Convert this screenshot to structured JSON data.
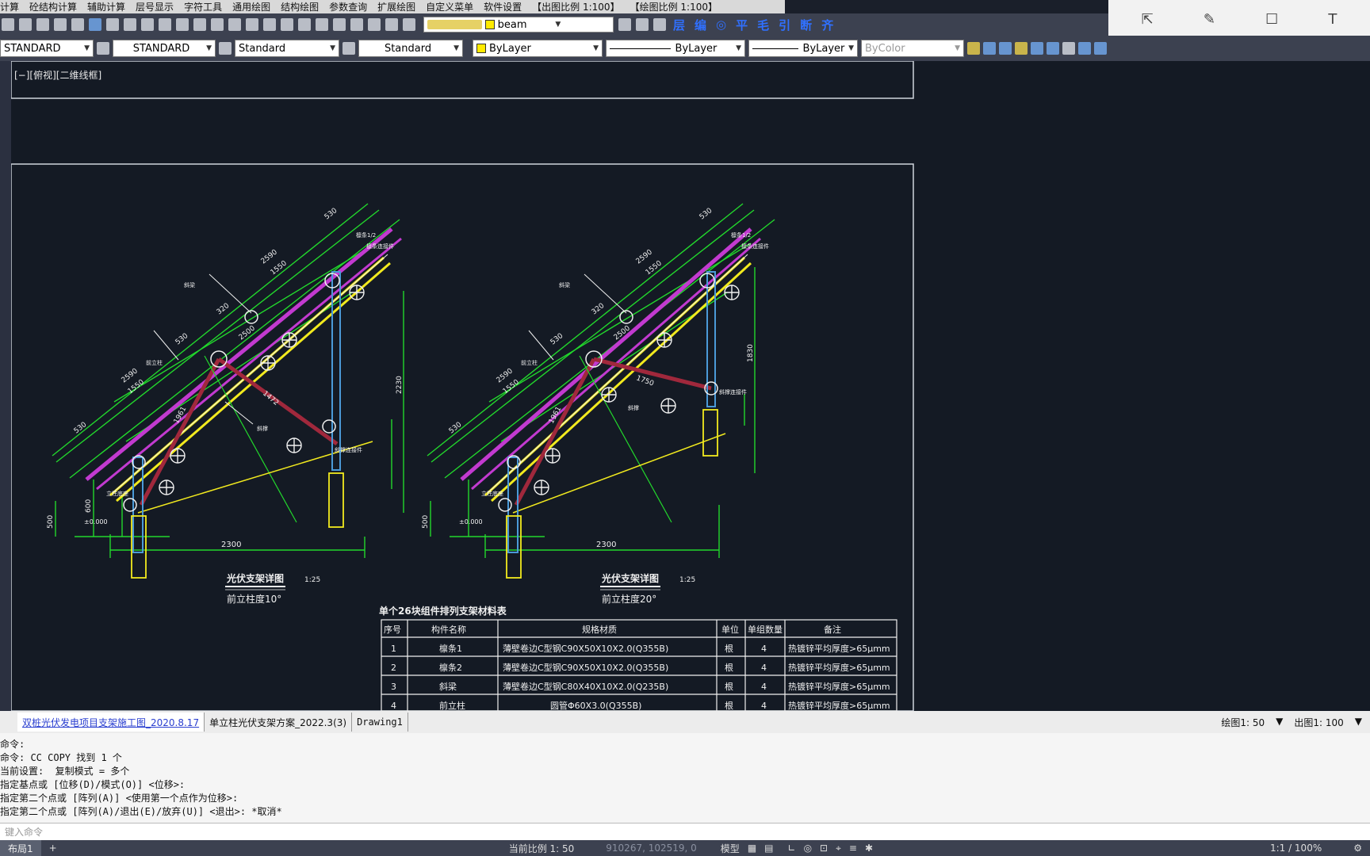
{
  "menu": [
    "计算",
    "砼结构计算",
    "辅助计算",
    "层号显示",
    "字符工具",
    "通用绘图",
    "结构绘图",
    "参数查询",
    "扩展绘图",
    "自定义菜单",
    "软件设置",
    "【出图比例 1:100】",
    "【绘图比例 1:100】"
  ],
  "layer": {
    "name": "beam"
  },
  "toolbar2": {
    "text_style": "STANDARD",
    "dim_style": "STANDARD",
    "table_style": "Standard",
    "mleader_style": "Standard",
    "color": "ByLayer",
    "linetype": "ByLayer",
    "lineweight": "ByLayer",
    "plotstyle": "ByColor"
  },
  "viewport": {
    "label": "[−][俯视][二维线框]"
  },
  "drawing": {
    "left": {
      "title": "光伏支架详图",
      "subtitle": "前立柱度10°",
      "scale": "1:25",
      "span": "2300",
      "dims": [
        "530",
        "2590",
        "1550",
        "320",
        "530",
        "2590",
        "1550",
        "320",
        "2500",
        "1961",
        "1472",
        "2230",
        "500",
        "600",
        "±0.000"
      ]
    },
    "right": {
      "title": "光伏支架详图",
      "subtitle": "前立柱度20°",
      "scale": "1:25",
      "span": "2300",
      "dims": [
        "530",
        "2590",
        "1550",
        "320",
        "530",
        "2590",
        "1550",
        "2500",
        "1961",
        "1750",
        "1830",
        "500",
        "±0.000"
      ]
    },
    "callouts": [
      "檩条1/2",
      "檩条连接件",
      "斜梁",
      "前立柱",
      "后立柱",
      "斜撑",
      "斜撑连接件",
      "立柱底座"
    ],
    "table": {
      "title": "单个26块组件排列支架材料表",
      "headers": [
        "序号",
        "构件名称",
        "规格材质",
        "单位",
        "单组数量",
        "备注"
      ],
      "rows": [
        [
          "1",
          "檩条1",
          "薄壁卷边C型钢C90X50X10X2.0(Q355B)",
          "根",
          "4",
          "热镀锌平均厚度>65μmm"
        ],
        [
          "2",
          "檩条2",
          "薄壁卷边C型钢C90X50X10X2.0(Q355B)",
          "根",
          "4",
          "热镀锌平均厚度>65μmm"
        ],
        [
          "3",
          "斜梁",
          "薄壁卷边C型钢C80X40X10X2.0(Q235B)",
          "根",
          "4",
          "热镀锌平均厚度>65μmm"
        ],
        [
          "4",
          "前立柱",
          "圆管Φ60X3.0(Q355B)",
          "根",
          "4",
          "热镀锌平均厚度>65μmm"
        ]
      ]
    }
  },
  "tabs": [
    "双桩光伏发电项目支架施工图_2020.8.17",
    "单立柱光伏支架方案_2022.3(3)",
    "Drawing1"
  ],
  "scale": {
    "draw": "绘图1: 50",
    "plot": "出图1: 100"
  },
  "command_history": [
    "命令:",
    "命令: CC COPY 找到 1 个",
    "当前设置:  复制模式 = 多个",
    "指定基点或 [位移(D)/模式(O)] <位移>:",
    "指定第二个点或 [阵列(A)] <使用第一个点作为位移>:",
    "指定第二个点或 [阵列(A)/退出(E)/放弃(U)] <退出>: *取消*"
  ],
  "command_placeholder": "键入命令",
  "status": {
    "layout": "布局1",
    "scale_label": "当前比例 1: 50",
    "coords": "910267, 102519, 0",
    "model": "模型",
    "zoom": "1:1 / 100%"
  },
  "colors": {
    "green": "#22d82c",
    "yellow": "#f2ea1e",
    "magenta": "#c23ad0",
    "maroon": "#a0283c",
    "blue": "#4b9ad8",
    "white": "#f0f0f0"
  }
}
